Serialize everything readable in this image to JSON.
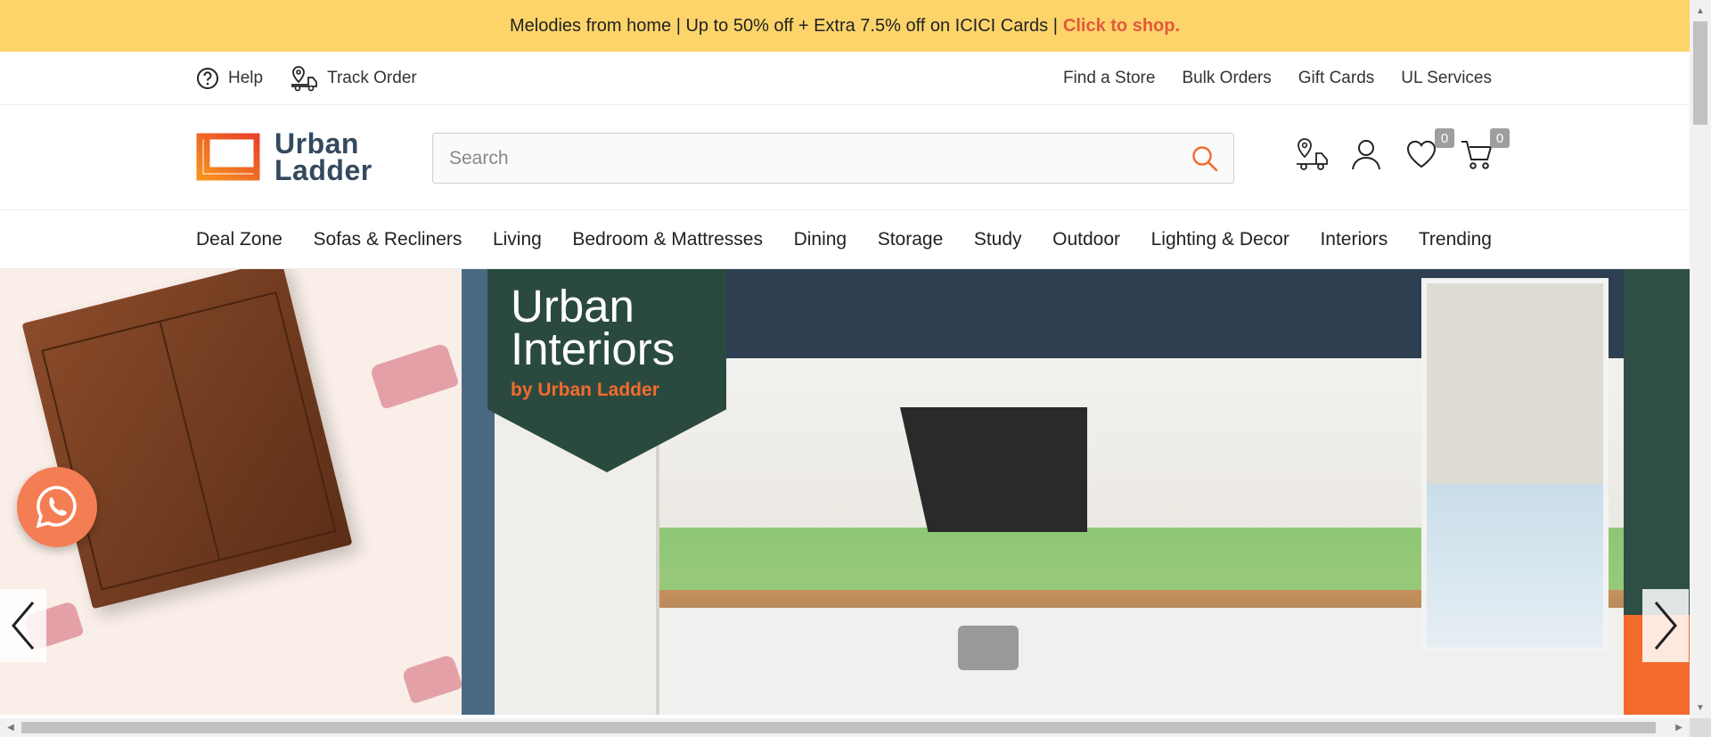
{
  "promo": {
    "text": "Melodies from home | Up to 50% off + Extra 7.5% off on ICICI Cards |",
    "cta": "Click to shop."
  },
  "utility": {
    "help": "Help",
    "track_order": "Track Order",
    "links": [
      "Find a Store",
      "Bulk Orders",
      "Gift Cards",
      "UL Services"
    ]
  },
  "logo": {
    "line1": "Urban",
    "line2": "Ladder"
  },
  "search": {
    "placeholder": "Search"
  },
  "header": {
    "wishlist_count": "0",
    "cart_count": "0"
  },
  "nav": [
    "Deal Zone",
    "Sofas & Recliners",
    "Living",
    "Bedroom & Mattresses",
    "Dining",
    "Storage",
    "Study",
    "Outdoor",
    "Lighting & Decor",
    "Interiors",
    "Trending"
  ],
  "hero": {
    "brand_line1": "Urban",
    "brand_line2": "Interiors",
    "brand_sub": "by Urban Ladder"
  },
  "colors": {
    "promo_bg": "#fdd46a",
    "cta": "#e05a3d",
    "accent": "#f36b2c",
    "whatsapp": "#f57d53"
  }
}
